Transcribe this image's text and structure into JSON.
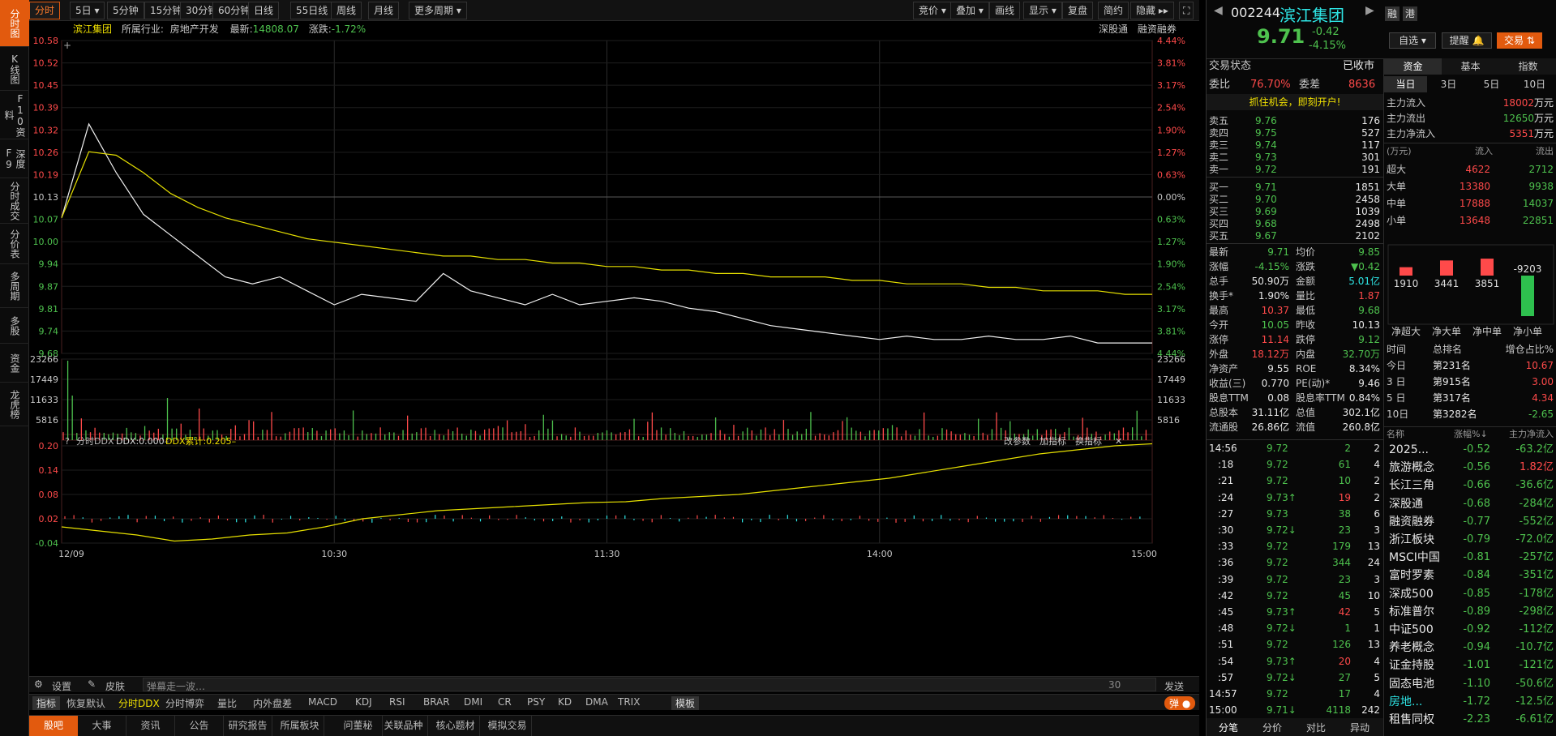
{
  "sidebar": [
    "分时图",
    "K线图",
    "F10资料",
    "深度F9",
    "分时成交",
    "分价表",
    "多周期",
    "多股",
    "资金",
    "龙虎榜"
  ],
  "toolbar": {
    "periods": [
      "分时",
      "5日",
      "5分钟",
      "15分钟",
      "30分钟",
      "60分钟",
      "日线",
      "55日线",
      "周线",
      "月线",
      "更多周期"
    ],
    "right": [
      "竞价",
      "叠加",
      "画线",
      "显示",
      "复盘",
      "简约",
      "隐藏"
    ]
  },
  "info": {
    "name": "滨江集团",
    "industry_label": "所属行业:",
    "industry": "房地产开发",
    "latest_label": "最新:",
    "latest": "14808.07",
    "change_label": "涨跌:",
    "change": "-1.72%",
    "btn1": "深股通",
    "btn2": "融资融券"
  },
  "axes": {
    "price_ticks": [
      "10.58",
      "10.52",
      "10.45",
      "10.39",
      "10.32",
      "10.26",
      "10.19",
      "10.13",
      "10.07",
      "10.00",
      "9.94",
      "9.87",
      "9.81",
      "9.74",
      "9.68"
    ],
    "pct_ticks": [
      "4.44%",
      "3.81%",
      "3.17%",
      "2.54%",
      "1.90%",
      "1.27%",
      "0.63%",
      "0.00%",
      "0.63%",
      "1.27%",
      "1.90%",
      "2.54%",
      "3.17%",
      "3.81%",
      "4.44%"
    ],
    "vol_ticks": [
      "23266",
      "17449",
      "11633",
      "5816"
    ],
    "ddx_ticks": [
      "0.20",
      "0.14",
      "0.08",
      "0.02",
      "-0.04"
    ],
    "time_ticks": [
      "12/09",
      "10:30",
      "11:30",
      "14:00",
      "15:00"
    ]
  },
  "ddx": {
    "title": "分时DDX",
    "ddx_label": "DDX:0.000–",
    "cum_label": "DDX累计:0.205–",
    "btns": [
      "改参数",
      "加指标",
      "换指标"
    ]
  },
  "chart_data": {
    "type": "line",
    "title": "滨江集团",
    "prev_close": 10.13,
    "ylim": [
      9.68,
      10.58
    ],
    "series": [
      {
        "name": "price",
        "values": [
          10.07,
          10.34,
          10.2,
          10.08,
          10.02,
          9.96,
          9.9,
          9.88,
          9.9,
          9.86,
          9.82,
          9.85,
          9.84,
          9.83,
          9.91,
          9.86,
          9.84,
          9.82,
          9.85,
          9.82,
          9.83,
          9.84,
          9.83,
          9.81,
          9.8,
          9.78,
          9.76,
          9.75,
          9.74,
          9.73,
          9.72,
          9.73,
          9.72,
          9.72,
          9.73,
          9.72,
          9.72,
          9.73,
          9.71,
          9.71,
          9.71
        ]
      },
      {
        "name": "avg",
        "values": [
          10.07,
          10.26,
          10.25,
          10.2,
          10.14,
          10.1,
          10.07,
          10.05,
          10.03,
          10.01,
          10.0,
          9.99,
          9.98,
          9.97,
          9.96,
          9.96,
          9.95,
          9.95,
          9.94,
          9.94,
          9.93,
          9.93,
          9.92,
          9.92,
          9.91,
          9.91,
          9.9,
          9.9,
          9.9,
          9.89,
          9.89,
          9.88,
          9.88,
          9.88,
          9.87,
          9.87,
          9.86,
          9.86,
          9.86,
          9.85,
          9.85
        ]
      }
    ],
    "volume_ylim": [
      0,
      23266
    ],
    "ddx_ylim": [
      -0.04,
      0.2
    ],
    "ddx_cum": [
      0,
      -0.01,
      -0.02,
      -0.035,
      -0.03,
      -0.02,
      -0.015,
      0.0,
      0.02,
      0.03,
      0.04,
      0.045,
      0.05,
      0.055,
      0.06,
      0.062,
      0.07,
      0.075,
      0.08,
      0.09,
      0.1,
      0.11,
      0.12,
      0.135,
      0.15,
      0.165,
      0.18,
      0.19,
      0.2,
      0.205
    ]
  },
  "bottom": {
    "settings": "设置",
    "skin": "皮肤",
    "danmu_placeholder": "弹幕走一波…",
    "danmu_count": "30",
    "send": "发送",
    "indicators": [
      "指标",
      "恢复默认",
      "分时DDX",
      "分时博弈",
      "量比",
      "内外盘差",
      "MACD",
      "KDJ",
      "RSI",
      "BRAR",
      "DMI",
      "CR",
      "PSY",
      "KD",
      "DMA",
      "TRIX",
      "模板"
    ],
    "tabs": [
      "股吧",
      "大事",
      "资讯",
      "公告",
      "研究报告",
      "所属板块",
      "问董秘",
      "关联品种",
      "核心题材",
      "模拟交易"
    ],
    "danmu_toggle": "弹"
  },
  "stock": {
    "code": "002244",
    "name": "滨江集团",
    "tag1": "融",
    "tag2": "港",
    "price": "9.71",
    "chg": "-0.42",
    "pct": "-4.15%",
    "btn_zixuan": "自选",
    "btn_tixing": "提醒",
    "btn_trade": "交易"
  },
  "quote": {
    "status_label": "交易状态",
    "status": "已收市",
    "weibi_label": "委比",
    "weibi": "76.70%",
    "weicha_label": "委差",
    "weicha": "8636",
    "ad": "抓住机会，即刻开户!",
    "sells": [
      [
        "卖五",
        "9.76",
        "176"
      ],
      [
        "卖四",
        "9.75",
        "527"
      ],
      [
        "卖三",
        "9.74",
        "117"
      ],
      [
        "卖二",
        "9.73",
        "301"
      ],
      [
        "卖一",
        "9.72",
        "191"
      ]
    ],
    "buys": [
      [
        "买一",
        "9.71",
        "1851"
      ],
      [
        "买二",
        "9.70",
        "2458"
      ],
      [
        "买三",
        "9.69",
        "1039"
      ],
      [
        "买四",
        "9.68",
        "2498"
      ],
      [
        "买五",
        "9.67",
        "2102"
      ]
    ],
    "stats": [
      [
        "最新",
        "9.71",
        "均价",
        "9.85"
      ],
      [
        "涨幅",
        "-4.15%",
        "涨跌",
        "▼0.42"
      ],
      [
        "总手",
        "50.90万",
        "金额",
        "5.01亿"
      ],
      [
        "换手*",
        "1.90%",
        "量比",
        "1.87"
      ],
      [
        "最高",
        "10.37",
        "最低",
        "9.68"
      ],
      [
        "今开",
        "10.05",
        "昨收",
        "10.13"
      ],
      [
        "涨停",
        "11.14",
        "跌停",
        "9.12"
      ],
      [
        "外盘",
        "18.12万",
        "内盘",
        "32.70万"
      ],
      [
        "净资产",
        "9.55",
        "ROE",
        "8.34%"
      ],
      [
        "收益(三)",
        "0.770",
        "PE(动)*",
        "9.46"
      ],
      [
        "股息TTM",
        "0.08",
        "股息率TTM",
        "0.84%"
      ],
      [
        "总股本",
        "31.11亿",
        "总值",
        "302.1亿"
      ],
      [
        "流通股",
        "26.86亿",
        "流值",
        "260.8亿"
      ]
    ],
    "ticks": [
      [
        "14:56",
        "9.72",
        "2",
        "2"
      ],
      [
        ":18",
        "9.72",
        "61",
        "4"
      ],
      [
        ":21",
        "9.72",
        "10",
        "2"
      ],
      [
        ":24",
        "9.73↑",
        "19",
        "2"
      ],
      [
        ":27",
        "9.73",
        "38",
        "6"
      ],
      [
        ":30",
        "9.72↓",
        "23",
        "3"
      ],
      [
        ":33",
        "9.72",
        "179",
        "13"
      ],
      [
        ":36",
        "9.72",
        "344",
        "24"
      ],
      [
        ":39",
        "9.72",
        "23",
        "3"
      ],
      [
        ":42",
        "9.72",
        "45",
        "10"
      ],
      [
        ":45",
        "9.73↑",
        "42",
        "5"
      ],
      [
        ":48",
        "9.72↓",
        "1",
        "1"
      ],
      [
        ":51",
        "9.72",
        "126",
        "13"
      ],
      [
        ":54",
        "9.73↑",
        "20",
        "4"
      ],
      [
        ":57",
        "9.72↓",
        "27",
        "5"
      ],
      [
        "14:57",
        "9.72",
        "17",
        "4"
      ],
      [
        "15:00",
        "9.71↓",
        "4118",
        "242"
      ]
    ],
    "tabs_bottom": [
      "分笔",
      "分价",
      "对比",
      "异动"
    ]
  },
  "fund": {
    "tabs": [
      "资金",
      "基本",
      "指数"
    ],
    "periods": [
      "当日",
      "3日",
      "5日",
      "10日"
    ],
    "main_in_label": "主力流入",
    "main_in": "18002万元",
    "main_out_label": "主力流出",
    "main_out": "12650万元",
    "main_net_label": "主力净流入",
    "main_net": "5351万元",
    "unit": "(万元)",
    "in_h": "流入",
    "out_h": "流出",
    "rows": [
      [
        "超大",
        "4622",
        "2712"
      ],
      [
        "大单",
        "13380",
        "9938"
      ],
      [
        "中单",
        "17888",
        "14037"
      ],
      [
        "小单",
        "13648",
        "22851"
      ]
    ],
    "bars": [
      [
        "1910",
        1910
      ],
      [
        "3441",
        3441
      ],
      [
        "3851",
        3851
      ],
      [
        "-9203",
        -9203
      ]
    ],
    "bar_labels": [
      "净超大",
      "净大单",
      "净中单",
      "净小单"
    ],
    "rank_h": [
      "时间",
      "总排名",
      "增仓占比%"
    ],
    "rank": [
      [
        "今日",
        "第231名",
        "10.67"
      ],
      [
        "3 日",
        "第915名",
        "3.00"
      ],
      [
        "5 日",
        "第317名",
        "4.34"
      ],
      [
        "10日",
        "第3282名",
        "-2.65"
      ]
    ],
    "sector_h": [
      "名称",
      "涨幅%↓",
      "主力净流入"
    ],
    "sectors": [
      [
        "2025...",
        "-0.52",
        "-63.2亿"
      ],
      [
        "旅游概念",
        "-0.56",
        "1.82亿"
      ],
      [
        "长江三角",
        "-0.66",
        "-36.6亿"
      ],
      [
        "深股通",
        "-0.68",
        "-284亿"
      ],
      [
        "融资融券",
        "-0.77",
        "-552亿"
      ],
      [
        "浙江板块",
        "-0.79",
        "-72.0亿"
      ],
      [
        "MSCI中国",
        "-0.81",
        "-257亿"
      ],
      [
        "富时罗素",
        "-0.84",
        "-351亿"
      ],
      [
        "深成500",
        "-0.85",
        "-178亿"
      ],
      [
        "标准普尔",
        "-0.89",
        "-298亿"
      ],
      [
        "中证500",
        "-0.92",
        "-112亿"
      ],
      [
        "养老概念",
        "-0.94",
        "-10.7亿"
      ],
      [
        "证金持股",
        "-1.01",
        "-121亿"
      ],
      [
        "固态电池",
        "-1.10",
        "-50.6亿"
      ],
      [
        "房地...",
        "-1.72",
        "-12.5亿"
      ],
      [
        "租售同权",
        "-2.23",
        "-6.61亿"
      ]
    ]
  }
}
